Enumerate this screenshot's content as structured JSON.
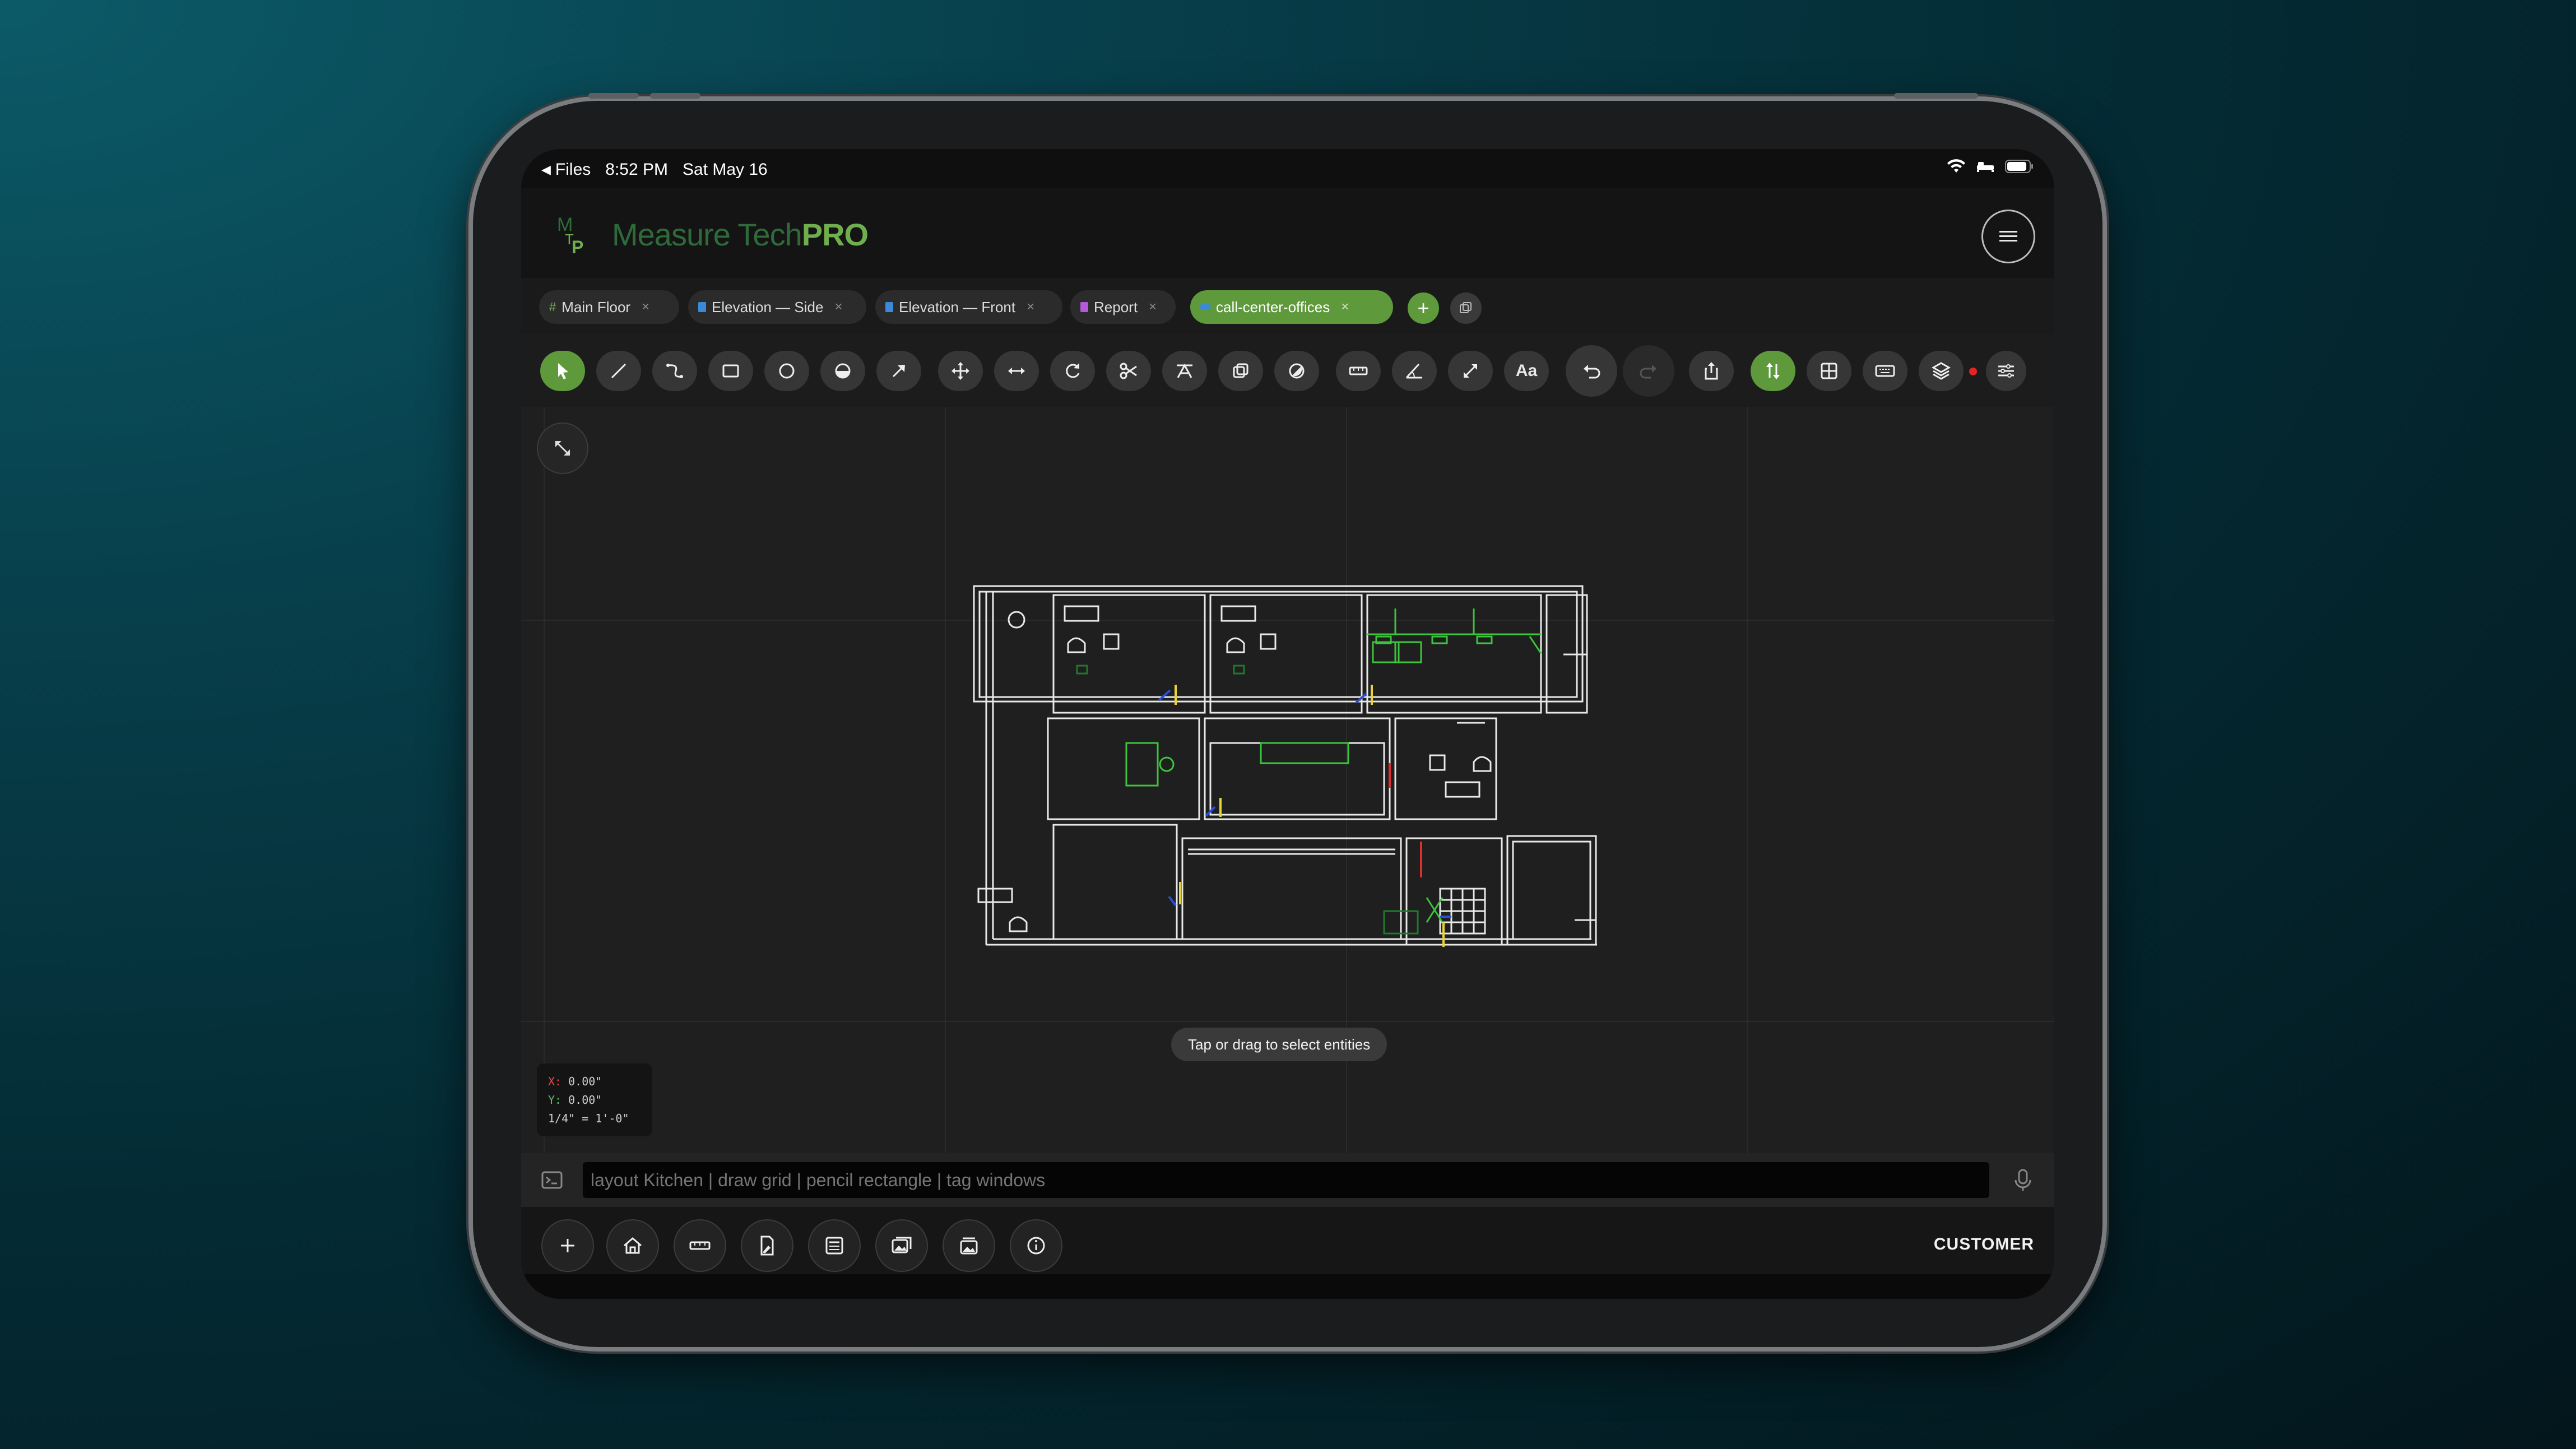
{
  "status_bar": {
    "back_app": "Files",
    "time": "8:52 PM",
    "date": "Sat May 16"
  },
  "header": {
    "logo_initials": "MTP",
    "brand_prefix": "Measure Tech",
    "brand_suffix": "PRO"
  },
  "tabs": [
    {
      "label": "Main Floor",
      "icon": "grid-icon",
      "color": "#6fae4c",
      "active": false
    },
    {
      "label": "Elevation — Side",
      "icon": "document-icon",
      "color": "#3a8ad8",
      "active": false
    },
    {
      "label": "Elevation — Front",
      "icon": "document-icon",
      "color": "#3a8ad8",
      "active": false
    },
    {
      "label": "Report",
      "icon": "document-icon",
      "color": "#b45ad8",
      "active": false
    },
    {
      "label": "call-center-offices",
      "icon": "layout-icon",
      "color": "#3a8ad8",
      "active": true
    }
  ],
  "tab_close_glyph": "×",
  "tab_add_glyph": "+",
  "toolbar": {
    "tools": [
      "select",
      "line",
      "arc",
      "rectangle",
      "circle",
      "half-circle",
      "arrow",
      "move",
      "mirror",
      "rotate",
      "cut",
      "offset",
      "copy",
      "fill",
      "dimension",
      "angle",
      "scale",
      "text",
      "undo",
      "redo",
      "share",
      "flip",
      "table",
      "keyboard",
      "layers",
      "settings"
    ],
    "text_tool_label": "Aa",
    "accent_color": "#5e9a3c",
    "record_color": "#e52424"
  },
  "canvas": {
    "hint": "Tap or drag to select entities",
    "coords": {
      "x_label": "X:",
      "x_value": "0.00\"",
      "y_label": "Y:",
      "y_value": "0.00\"",
      "scale": "1/4\" = 1'-0\""
    }
  },
  "command_bar": {
    "placeholder": "layout Kitchen | draw grid | pencil rectangle | tag windows"
  },
  "bottom_bar": {
    "buttons": [
      "add",
      "home",
      "ruler",
      "doc-pen",
      "sheet",
      "gallery",
      "photos",
      "info"
    ],
    "mode_label": "CUSTOMER"
  }
}
